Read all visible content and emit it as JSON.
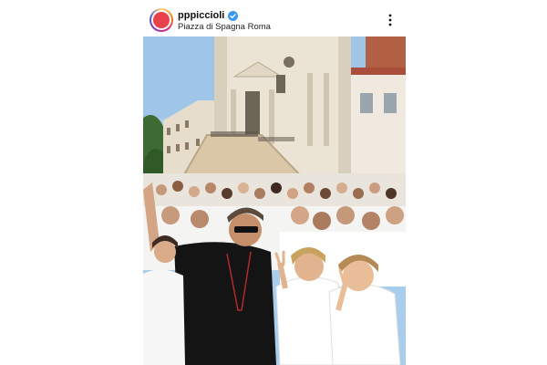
{
  "post": {
    "username": "pppiccioli",
    "location": "Piazza di Spagna Roma",
    "verified": true
  },
  "icons": {
    "verified": "verified-badge-icon",
    "more": "more-options-icon"
  },
  "colors": {
    "verified_blue": "#3897f0",
    "avatar_red": "#e8434a",
    "sky": "#a9cdec",
    "church_stone": "#ebe3d3"
  }
}
